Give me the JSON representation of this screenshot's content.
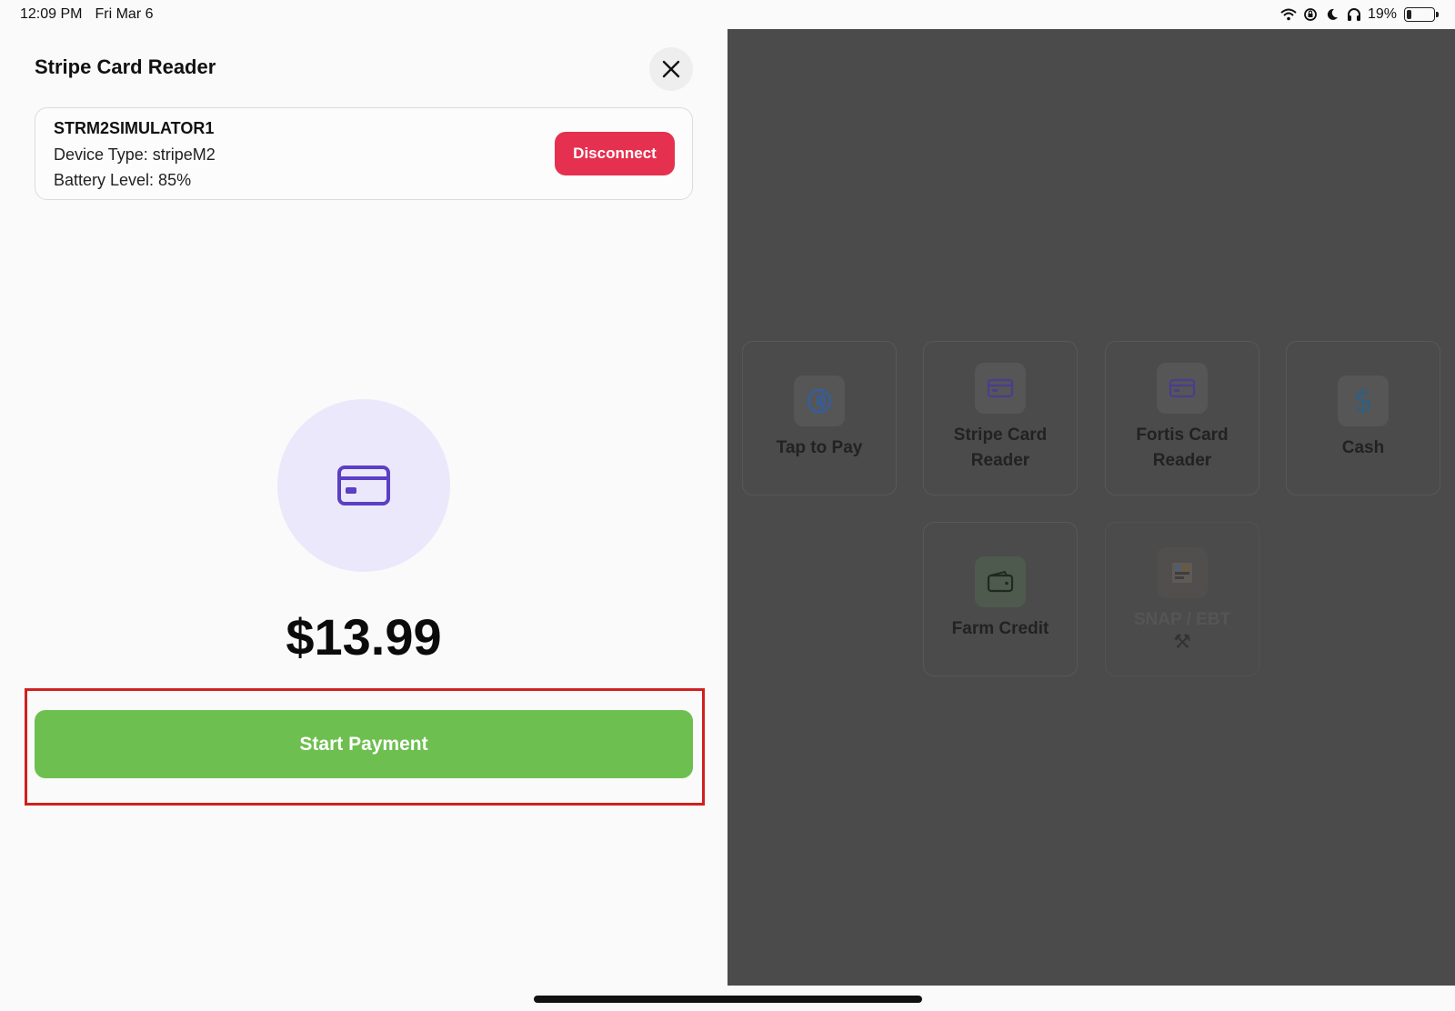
{
  "status_bar": {
    "time": "12:09 PM",
    "date": "Fri Mar 6",
    "battery_percent": "19%",
    "battery_level": 0.19,
    "icons": [
      "wifi-icon",
      "lock-rotation-icon",
      "moon-icon",
      "headphones-icon",
      "battery-icon"
    ]
  },
  "sheet": {
    "title": "Stripe Card Reader",
    "device": {
      "name": "STRM2SIMULATOR1",
      "type_line": "Device Type: stripeM2",
      "battery_line": "Battery Level: 85%",
      "disconnect_label": "Disconnect"
    },
    "amount": "$13.99",
    "start_payment_label": "Start Payment"
  },
  "payment_methods": [
    {
      "label": "Tap to Pay",
      "icon": "contactless-icon"
    },
    {
      "label": "Stripe Card Reader",
      "icon": "credit-card-icon"
    },
    {
      "label": "Fortis Card Reader",
      "icon": "credit-card-icon"
    },
    {
      "label": "Cash",
      "icon": "dollar-icon"
    },
    {
      "label": "Farm Credit",
      "icon": "wallet-icon"
    },
    {
      "label": "SNAP / EBT",
      "sublabel": "⚒",
      "icon": "snap-ebt-logo-icon"
    }
  ],
  "colors": {
    "disconnect": "#e5304f",
    "start_payment": "#6dbf4f",
    "card_circle": "#ece8fb",
    "card_icon": "#5b3fc4",
    "highlight": "#d01f1f",
    "backdrop": "#4b4b4b"
  }
}
